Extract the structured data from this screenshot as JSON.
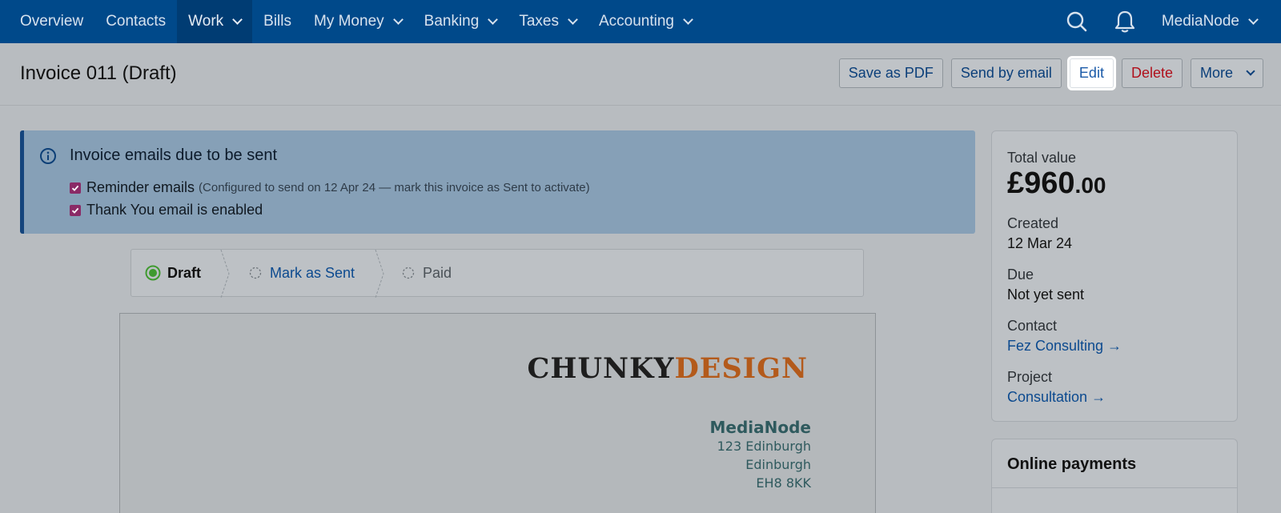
{
  "nav": {
    "items": [
      {
        "label": "Overview",
        "dropdown": false
      },
      {
        "label": "Contacts",
        "dropdown": false
      },
      {
        "label": "Work",
        "dropdown": true,
        "active": true
      },
      {
        "label": "Bills",
        "dropdown": false
      },
      {
        "label": "My Money",
        "dropdown": true
      },
      {
        "label": "Banking",
        "dropdown": true
      },
      {
        "label": "Taxes",
        "dropdown": true
      },
      {
        "label": "Accounting",
        "dropdown": true
      }
    ],
    "org_name": "MediaNode",
    "icons": [
      "search-icon",
      "bell-icon"
    ]
  },
  "header": {
    "title": "Invoice 011 (Draft)",
    "actions": {
      "save_pdf": "Save as PDF",
      "send_email": "Send by email",
      "edit": "Edit",
      "delete": "Delete",
      "more": "More"
    }
  },
  "banner": {
    "title": "Invoice emails due to be sent",
    "reminder_label": "Reminder emails",
    "reminder_note": "(Configured to send on 12 Apr 24 — mark this invoice as Sent to activate)",
    "reminder_checked": true,
    "thankyou_label": "Thank You email is enabled",
    "thankyou_checked": true
  },
  "steps": {
    "draft": "Draft",
    "sent": "Mark as Sent",
    "paid": "Paid",
    "current": "draft"
  },
  "invoice": {
    "logo_part1": "CHUNKY",
    "logo_part2": "DESIGN",
    "from_name": "MediaNode",
    "address_lines": [
      "123 Edinburgh",
      "Edinburgh",
      "EH8 8KK"
    ]
  },
  "summary": {
    "total_label": "Total value",
    "total_main": "£960",
    "total_pence": ".00",
    "created_label": "Created",
    "created_value": "12 Mar 24",
    "due_label": "Due",
    "due_value": "Not yet sent",
    "contact_label": "Contact",
    "contact_value": "Fez Consulting →",
    "project_label": "Project",
    "project_value": "Consultation →"
  },
  "online_payments": {
    "title": "Online payments"
  },
  "colors": {
    "nav_bg": "#00498a",
    "banner_bg": "#86a0b7",
    "link": "#0c4a8f",
    "delete": "#b0101c",
    "logo_accent": "#b35a1b",
    "step_active": "#3f9a2f"
  }
}
